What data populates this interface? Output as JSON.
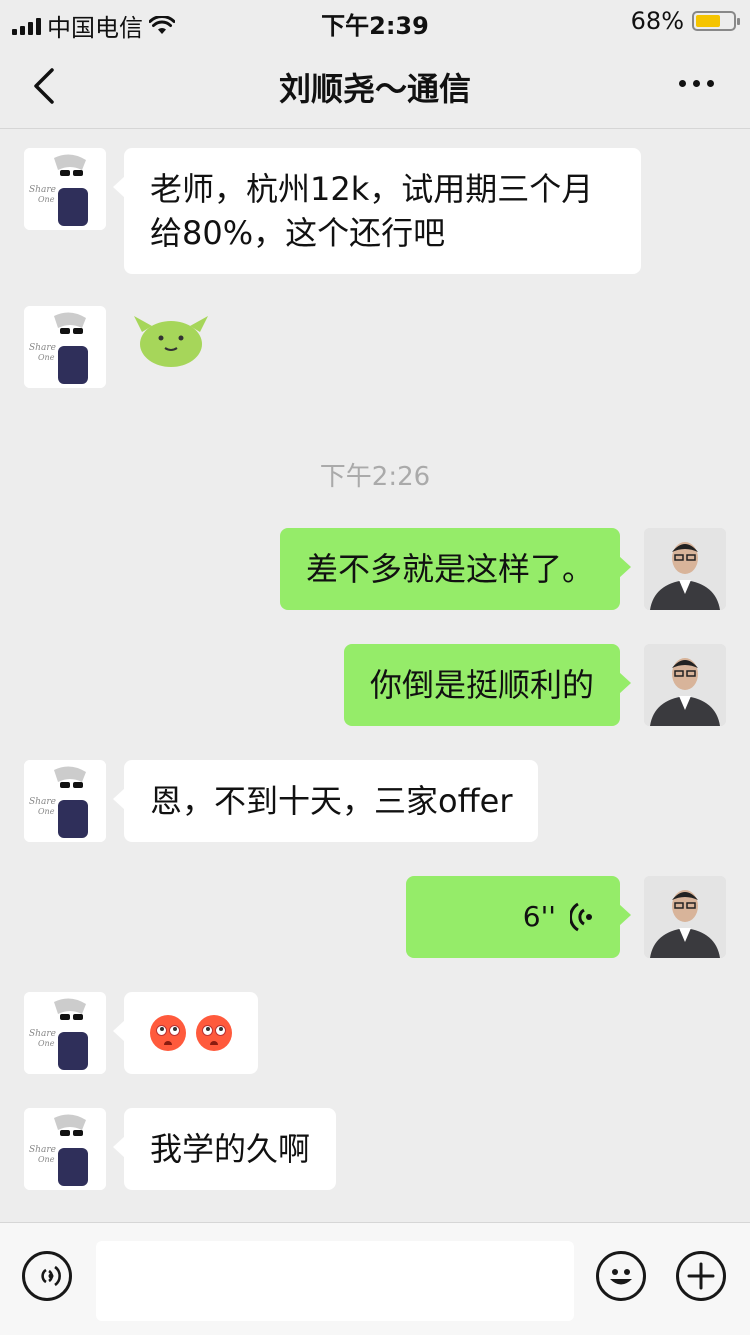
{
  "status_bar": {
    "carrier": "中国电信",
    "time": "下午2:39",
    "battery_percent_text": "68%",
    "battery_level": 0.68
  },
  "nav": {
    "title": "刘顺尧～通信",
    "back_icon": "chevron-left-icon",
    "more_icon": "more-dots-icon"
  },
  "messages": [
    {
      "side": "left",
      "type": "text",
      "lines": [
        "老师，杭州12k，试用期三个月",
        "给80%，这个还行吧"
      ]
    },
    {
      "side": "left",
      "type": "sticker",
      "sticker": "green-creature-sticker"
    },
    {
      "type": "timestamp",
      "text": "下午2:26"
    },
    {
      "side": "right",
      "type": "text",
      "text": "差不多就是这样了。"
    },
    {
      "side": "right",
      "type": "text",
      "text": "你倒是挺顺利的"
    },
    {
      "side": "left",
      "type": "text",
      "text": "恩，不到十天，三家offer"
    },
    {
      "side": "right",
      "type": "voice",
      "duration": "6''"
    },
    {
      "side": "left",
      "type": "emoji",
      "emoji": "flushed-face-emoji",
      "count": 2
    },
    {
      "side": "left",
      "type": "text",
      "text": "我学的久啊"
    }
  ],
  "input_bar": {
    "voice_icon": "voice-toggle-icon",
    "emoji_icon": "smiley-icon",
    "plus_icon": "plus-icon",
    "input_value": ""
  },
  "colors": {
    "background": "#ededed",
    "sent_bubble": "#95ec69",
    "received_bubble": "#ffffff",
    "battery": "#f5c400",
    "timestamp": "#aaaaaa"
  }
}
